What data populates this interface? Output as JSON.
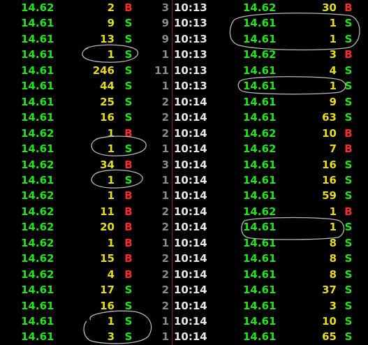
{
  "trades": [
    {
      "left": {
        "price": "14.62",
        "price_color": "#22e61a",
        "volume": "2",
        "side": "B",
        "count": "3"
      },
      "time": "10:13",
      "right": {
        "price": "14.62",
        "price_color": "#22e61a",
        "volume": "30",
        "side": "B"
      }
    },
    {
      "left": {
        "price": "14.61",
        "price_color": "#22e61a",
        "volume": "9",
        "side": "S",
        "count": "9"
      },
      "time": "10:13",
      "right": {
        "price": "14.61",
        "price_color": "#22e61a",
        "volume": "1",
        "side": "S"
      }
    },
    {
      "left": {
        "price": "14.61",
        "price_color": "#22e61a",
        "volume": "13",
        "side": "S",
        "count": "9"
      },
      "time": "10:13",
      "right": {
        "price": "14.61",
        "price_color": "#22e61a",
        "volume": "1",
        "side": "S"
      }
    },
    {
      "left": {
        "price": "14.61",
        "price_color": "#22e61a",
        "volume": "1",
        "side": "S",
        "count": "1"
      },
      "time": "10:13",
      "right": {
        "price": "14.62",
        "price_color": "#22e61a",
        "volume": "3",
        "side": "B"
      }
    },
    {
      "left": {
        "price": "14.61",
        "price_color": "#22e61a",
        "volume": "246",
        "side": "S",
        "count": "11"
      },
      "time": "10:13",
      "right": {
        "price": "14.61",
        "price_color": "#22e61a",
        "volume": "4",
        "side": "S"
      }
    },
    {
      "left": {
        "price": "14.61",
        "price_color": "#22e61a",
        "volume": "44",
        "side": "S",
        "count": "1"
      },
      "time": "10:13",
      "right": {
        "price": "14.61",
        "price_color": "#22e61a",
        "volume": "1",
        "side": "S"
      }
    },
    {
      "left": {
        "price": "14.61",
        "price_color": "#22e61a",
        "volume": "25",
        "side": "S",
        "count": "2"
      },
      "time": "10:14",
      "right": {
        "price": "14.61",
        "price_color": "#22e61a",
        "volume": "9",
        "side": "S"
      }
    },
    {
      "left": {
        "price": "14.61",
        "price_color": "#22e61a",
        "volume": "16",
        "side": "S",
        "count": "2"
      },
      "time": "10:14",
      "right": {
        "price": "14.61",
        "price_color": "#22e61a",
        "volume": "63",
        "side": "S"
      }
    },
    {
      "left": {
        "price": "14.62",
        "price_color": "#22e61a",
        "volume": "1",
        "side": "B",
        "count": "2"
      },
      "time": "10:14",
      "right": {
        "price": "14.62",
        "price_color": "#22e61a",
        "volume": "10",
        "side": "B"
      }
    },
    {
      "left": {
        "price": "14.61",
        "price_color": "#22e61a",
        "volume": "1",
        "side": "S",
        "count": "1"
      },
      "time": "10:14",
      "right": {
        "price": "14.62",
        "price_color": "#22e61a",
        "volume": "7",
        "side": "B"
      }
    },
    {
      "left": {
        "price": "14.62",
        "price_color": "#22e61a",
        "volume": "34",
        "side": "B",
        "count": "3"
      },
      "time": "10:14",
      "right": {
        "price": "14.61",
        "price_color": "#22e61a",
        "volume": "16",
        "side": "S"
      }
    },
    {
      "left": {
        "price": "14.61",
        "price_color": "#22e61a",
        "volume": "1",
        "side": "S",
        "count": "1"
      },
      "time": "10:14",
      "right": {
        "price": "14.61",
        "price_color": "#22e61a",
        "volume": "16",
        "side": "S"
      }
    },
    {
      "left": {
        "price": "14.62",
        "price_color": "#22e61a",
        "volume": "1",
        "side": "B",
        "count": "1"
      },
      "time": "10:14",
      "right": {
        "price": "14.61",
        "price_color": "#22e61a",
        "volume": "59",
        "side": "S"
      }
    },
    {
      "left": {
        "price": "14.62",
        "price_color": "#22e61a",
        "volume": "11",
        "side": "B",
        "count": "2"
      },
      "time": "10:14",
      "right": {
        "price": "14.62",
        "price_color": "#22e61a",
        "volume": "1",
        "side": "B"
      }
    },
    {
      "left": {
        "price": "14.62",
        "price_color": "#22e61a",
        "volume": "20",
        "side": "B",
        "count": "2"
      },
      "time": "10:14",
      "right": {
        "price": "14.61",
        "price_color": "#22e61a",
        "volume": "1",
        "side": "S"
      }
    },
    {
      "left": {
        "price": "14.62",
        "price_color": "#22e61a",
        "volume": "1",
        "side": "B",
        "count": "1"
      },
      "time": "10:14",
      "right": {
        "price": "14.61",
        "price_color": "#22e61a",
        "volume": "8",
        "side": "S"
      }
    },
    {
      "left": {
        "price": "14.62",
        "price_color": "#22e61a",
        "volume": "15",
        "side": "B",
        "count": "2"
      },
      "time": "10:14",
      "right": {
        "price": "14.61",
        "price_color": "#22e61a",
        "volume": "8",
        "side": "S"
      }
    },
    {
      "left": {
        "price": "14.62",
        "price_color": "#22e61a",
        "volume": "4",
        "side": "B",
        "count": "2"
      },
      "time": "10:14",
      "right": {
        "price": "14.61",
        "price_color": "#22e61a",
        "volume": "8",
        "side": "S"
      }
    },
    {
      "left": {
        "price": "14.61",
        "price_color": "#22e61a",
        "volume": "17",
        "side": "S",
        "count": "2"
      },
      "time": "10:14",
      "right": {
        "price": "14.61",
        "price_color": "#22e61a",
        "volume": "37",
        "side": "S"
      }
    },
    {
      "left": {
        "price": "14.61",
        "price_color": "#22e61a",
        "volume": "16",
        "side": "S",
        "count": "2"
      },
      "time": "10:14",
      "right": {
        "price": "14.61",
        "price_color": "#22e61a",
        "volume": "3",
        "side": "S"
      }
    },
    {
      "left": {
        "price": "14.61",
        "price_color": "#22e61a",
        "volume": "1",
        "side": "S",
        "count": "1"
      },
      "time": "10:14",
      "right": {
        "price": "14.61",
        "price_color": "#22e61a",
        "volume": "10",
        "side": "S"
      }
    },
    {
      "left": {
        "price": "14.61",
        "price_color": "#22e61a",
        "volume": "3",
        "side": "S",
        "count": "1"
      },
      "time": "10:14",
      "right": {
        "price": "14.61",
        "price_color": "#22e61a",
        "volume": "65",
        "side": "S"
      }
    }
  ],
  "colors": {
    "background": "#000000",
    "price_up": "#22e61a",
    "volume": "#e6dc1e",
    "buy": "#ff2a2a",
    "sell": "#22e61a",
    "count": "#8c8c8c",
    "time": "#e8e8e8",
    "divider": "#9a1a1a",
    "annotation": "#b8b8b8"
  }
}
